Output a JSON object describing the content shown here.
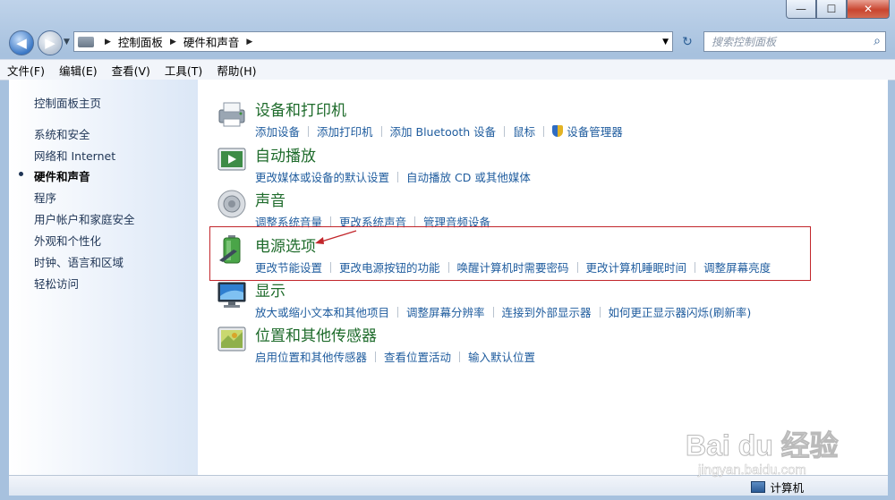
{
  "caption_buttons": {
    "minimize": "—",
    "maximize": "☐",
    "close": "✕"
  },
  "navigation": {
    "back_glyph": "◀",
    "forward_glyph": "▶",
    "dropdown_glyph": "▼"
  },
  "address_bar": {
    "crumbs": [
      "控制面板",
      "硬件和声音"
    ],
    "separator": "▶",
    "dropdown_glyph": "▼"
  },
  "refresh_glyph": "↻",
  "search": {
    "placeholder": "搜索控制面板",
    "icon_glyph": "⌕"
  },
  "menu": [
    "文件(F)",
    "编辑(E)",
    "查看(V)",
    "工具(T)",
    "帮助(H)"
  ],
  "sidebar": {
    "home": "控制面板主页",
    "items": [
      "系统和安全",
      "网络和 Internet",
      "硬件和声音",
      "程序",
      "用户帐户和家庭安全",
      "外观和个性化",
      "时钟、语言和区域",
      "轻松访问"
    ],
    "active_index": 2
  },
  "categories": [
    {
      "title": "设备和打印机",
      "icon": "printer-icon",
      "links": [
        "添加设备",
        "添加打印机",
        "添加 Bluetooth 设备",
        "鼠标",
        "设备管理器"
      ]
    },
    {
      "title": "自动播放",
      "icon": "autoplay-icon",
      "links": [
        "更改媒体或设备的默认设置",
        "自动播放 CD 或其他媒体"
      ]
    },
    {
      "title": "声音",
      "icon": "speaker-icon",
      "links": [
        "调整系统音量",
        "更改系统声音",
        "管理音频设备"
      ]
    },
    {
      "title": "电源选项",
      "icon": "battery-icon",
      "links": [
        "更改节能设置",
        "更改电源按钮的功能",
        "唤醒计算机时需要密码",
        "更改计算机睡眠时间",
        "调整屏幕亮度"
      ]
    },
    {
      "title": "显示",
      "icon": "display-icon",
      "links": [
        "放大或缩小文本和其他项目",
        "调整屏幕分辨率",
        "连接到外部显示器",
        "如何更正显示器闪烁(刷新率)"
      ]
    },
    {
      "title": "位置和其他传感器",
      "icon": "location-sensor-icon",
      "links": [
        "启用位置和其他传感器",
        "查看位置活动",
        "输入默认位置"
      ]
    }
  ],
  "status_bar": {
    "computer_label": "计算机"
  },
  "watermark": {
    "text": "Bai du 经验",
    "url": "jingyan.baidu.com"
  },
  "colors": {
    "category_title": "#1e6b2b",
    "link": "#1f5c9e",
    "highlight_box": "#c2262b"
  }
}
